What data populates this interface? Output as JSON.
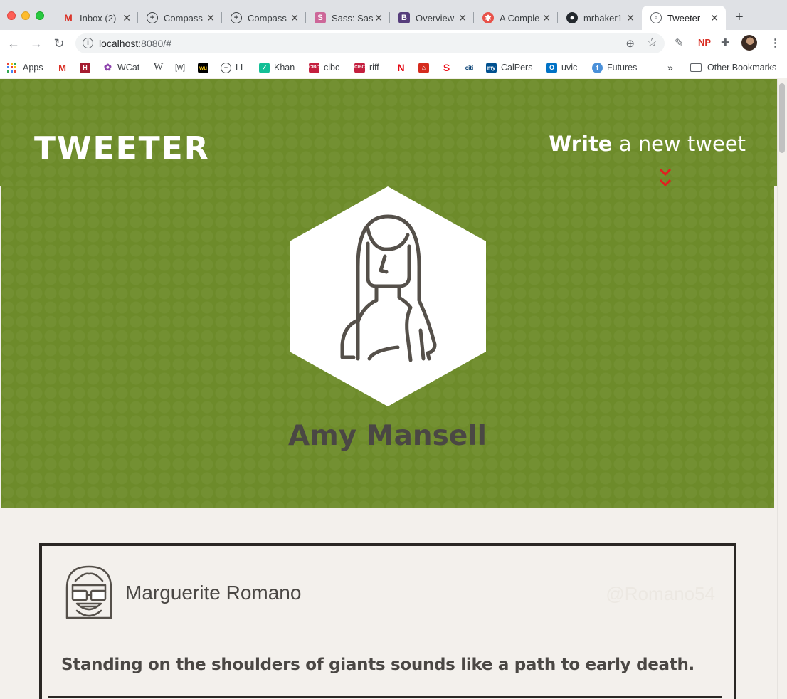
{
  "browser": {
    "tabs": [
      {
        "title": "Inbox (2)",
        "icon": "gmail-icon",
        "color": "#d93025"
      },
      {
        "title": "Compass",
        "icon": "compass-icon",
        "color": "#3c4043"
      },
      {
        "title": "Compass",
        "icon": "compass-icon",
        "color": "#3c4043"
      },
      {
        "title": "Sass: Sass",
        "icon": "sass-icon",
        "color": "#cd6799"
      },
      {
        "title": "Overview",
        "icon": "bootstrap-icon",
        "color": "#563d7c"
      },
      {
        "title": "A Comple",
        "icon": "css-tricks-icon",
        "color": "#e8524a"
      },
      {
        "title": "mrbaker1",
        "icon": "github-icon",
        "color": "#24292e"
      },
      {
        "title": "Tweeter",
        "icon": "globe-icon",
        "color": "#5f6368",
        "active": true
      }
    ],
    "url_host": "localhost",
    "url_rest": ":8080/#",
    "bookmarks": {
      "apps": "Apps",
      "wcat": "WCat",
      "wiki": "W",
      "w_bracket": "[w]",
      "ll": "LL",
      "khan": "Khan",
      "cibc": "cibc",
      "riff": "riff",
      "calpers": "CalPers",
      "uvic": "uvic",
      "futures": "Futures",
      "more": "»",
      "other": "Other Bookmarks"
    }
  },
  "app": {
    "logo": "TWEETER",
    "compose_bold": "Write",
    "compose_rest": " a new tweet",
    "accent": "#6d8b2a",
    "chevron_color": "#e02020"
  },
  "profile": {
    "name": "Amy Mansell"
  },
  "tweets": [
    {
      "author": "Marguerite Romano",
      "handle": "@Romano54",
      "text": "Standing on the shoulders of giants sounds like a path to early death."
    }
  ]
}
